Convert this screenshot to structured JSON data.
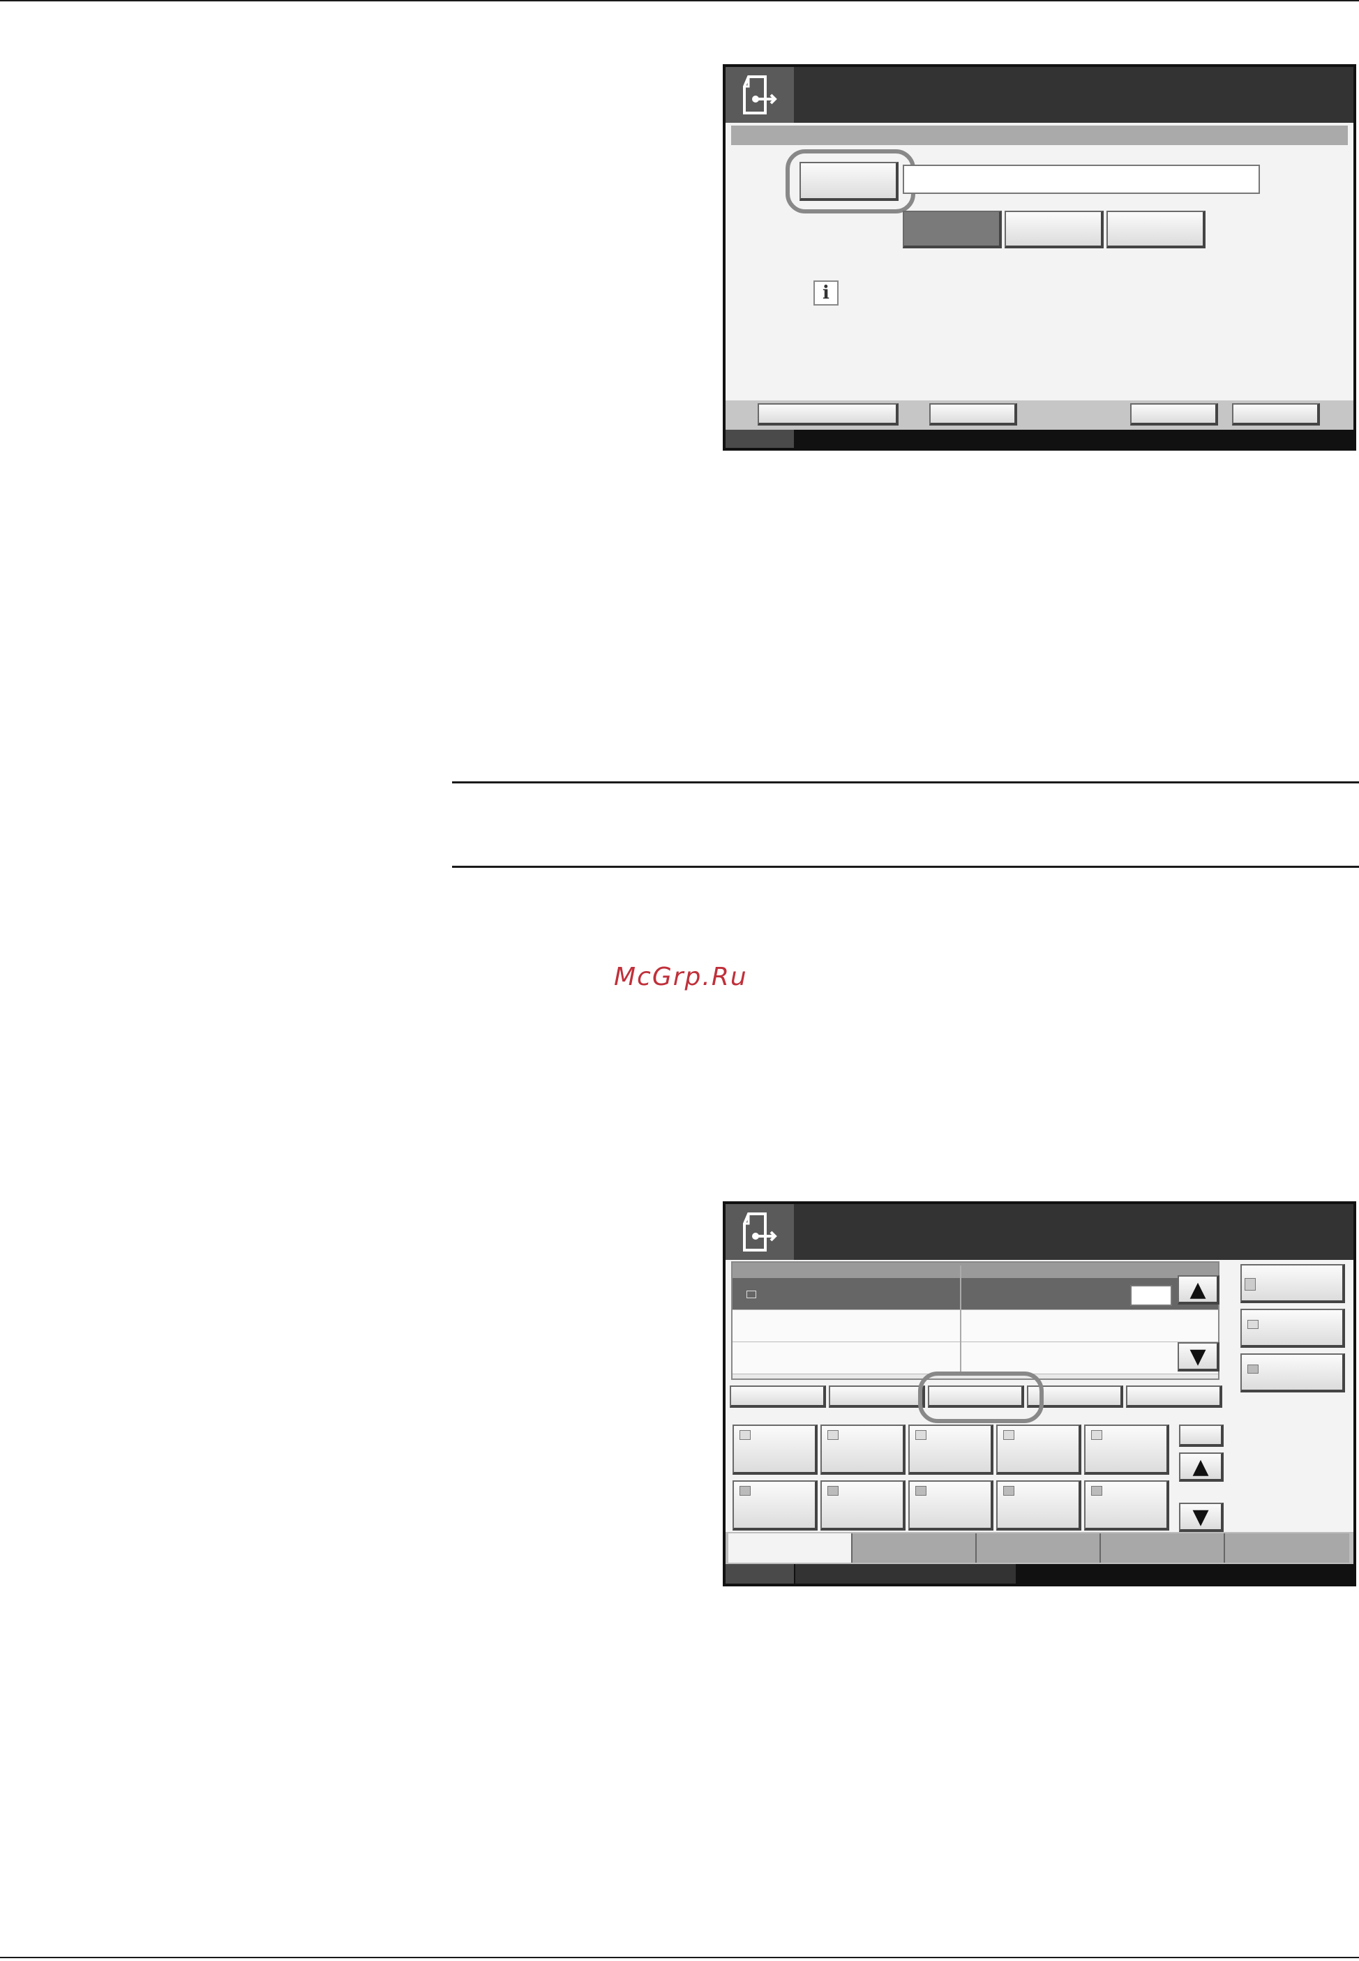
{
  "watermark": {
    "text": "McGrp.Ru"
  },
  "screen_one": {
    "title": "",
    "subtitle": "",
    "key_button_label": "",
    "input_value": "",
    "buttons": [
      "",
      "",
      ""
    ],
    "info_message": "",
    "footer_buttons": [
      "",
      "",
      "",
      ""
    ]
  },
  "screen_two": {
    "title": "",
    "list_rows": [
      "",
      "",
      ""
    ],
    "list_count": "",
    "side_buttons": [
      "",
      "",
      ""
    ],
    "filter_buttons": [
      "",
      "",
      "",
      "",
      ""
    ],
    "destination_tiles": [
      "",
      "",
      "",
      "",
      "",
      "",
      "",
      "",
      "",
      ""
    ],
    "tabs": [
      "",
      "",
      "",
      "",
      ""
    ]
  },
  "colors": {
    "panel_title_bg": "#333333",
    "highlight_ring": "#888888",
    "watermark": "#c0303a"
  },
  "icons": [
    "send-document-icon",
    "info-icon",
    "arrow-up-icon",
    "arrow-down-icon",
    "email-icon",
    "folder-icon"
  ]
}
